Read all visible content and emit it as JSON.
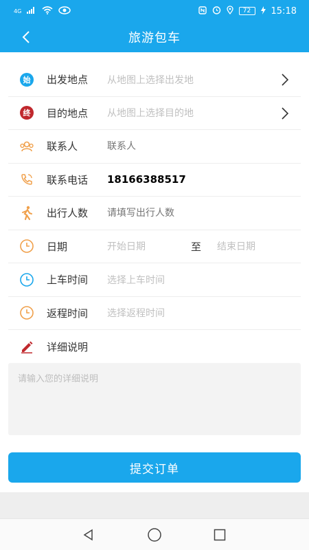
{
  "status_bar": {
    "network": "4G",
    "battery": "72",
    "time": "15:18"
  },
  "header": {
    "title": "旅游包车",
    "back_icon": "chevron-left-icon"
  },
  "form": {
    "departure": {
      "label": "出发地点",
      "placeholder": "从地图上选择出发地",
      "icon_text": "始",
      "icon_color": "#1aa7ec"
    },
    "destination": {
      "label": "目的地点",
      "placeholder": "从地图上选择目的地",
      "icon_text": "终",
      "icon_color": "#c0282d"
    },
    "contact": {
      "label": "联系人",
      "placeholder": "联系人"
    },
    "phone": {
      "label": "联系电话",
      "value": "18166388517"
    },
    "passengers": {
      "label": "出行人数",
      "placeholder": "请填写出行人数"
    },
    "date": {
      "label": "日期",
      "start_placeholder": "开始日期",
      "separator": "至",
      "end_placeholder": "结束日期"
    },
    "pickup_time": {
      "label": "上车时间",
      "placeholder": "选择上车时间"
    },
    "return_time": {
      "label": "返程时间",
      "placeholder": "选择返程时间"
    },
    "details": {
      "label": "详细说明",
      "placeholder": "请输入您的详细说明"
    }
  },
  "submit_label": "提交订单",
  "colors": {
    "primary": "#1aa7ec",
    "accent_orange": "#f0a04b",
    "accent_red": "#c0282d"
  }
}
